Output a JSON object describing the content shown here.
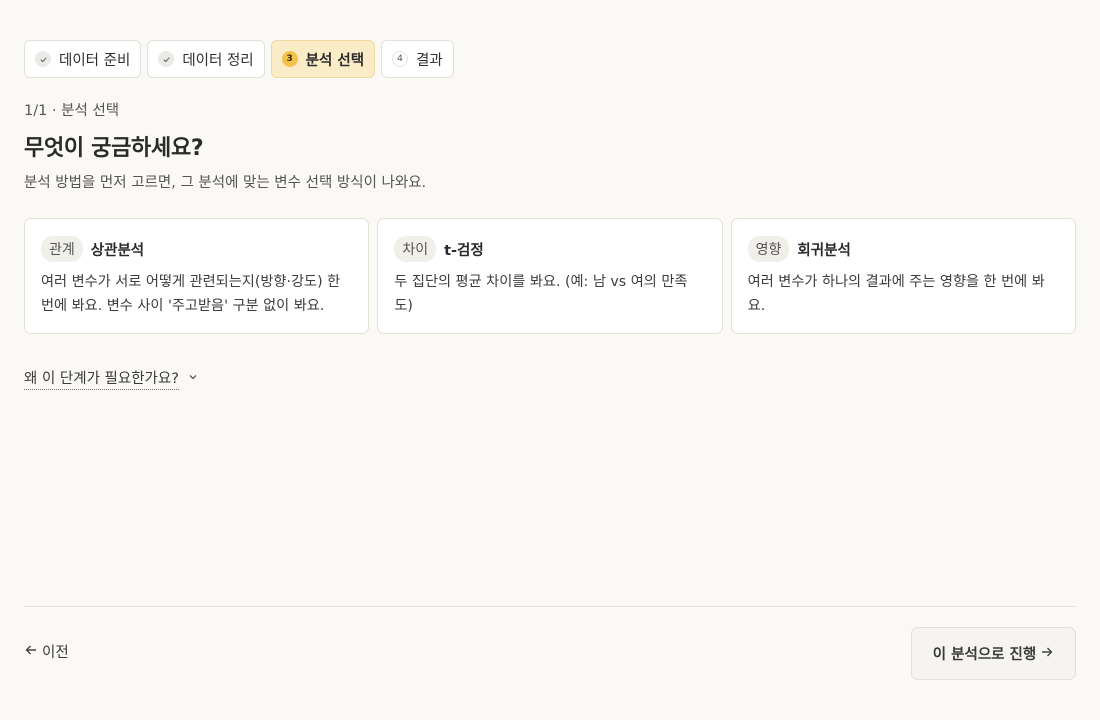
{
  "stepper": {
    "steps": [
      {
        "label": "데이터 준비",
        "state": "done",
        "icon": "check-icon"
      },
      {
        "label": "데이터 정리",
        "state": "done",
        "icon": "check-icon"
      },
      {
        "label": "분석 선택",
        "state": "current",
        "number": "3"
      },
      {
        "label": "결과",
        "state": "upcoming",
        "number": "4"
      }
    ]
  },
  "progress": "1/1 · 분석 선택",
  "title": "무엇이 궁금하세요?",
  "subtitle": "분석 방법을 먼저 고르면, 그 분석에 맞는 변수 선택 방식이 나와요.",
  "cards": [
    {
      "tag": "관계",
      "title": "상관분석",
      "desc": "여러 변수가 서로 어떻게 관련되는지(방향·강도) 한 번에 봐요. 변수 사이 '주고받음' 구분 없이 봐요."
    },
    {
      "tag": "차이",
      "title": "t-검정",
      "desc": "두 집단의 평균 차이를 봐요. (예: 남 vs 여의 만족도)"
    },
    {
      "tag": "영향",
      "title": "회귀분석",
      "desc": "여러 변수가 하나의 결과에 주는 영향을 한 번에 봐요."
    }
  ],
  "why_toggle": {
    "label": "왜 이 단계가 필요한가요?",
    "icon": "chevron-down-icon"
  },
  "footer": {
    "prev_label": "이전",
    "prev_icon": "arrow-left-icon",
    "next_label": "이 분석으로 진행",
    "next_icon": "arrow-right-icon"
  },
  "colors": {
    "background": "#faf9f6",
    "active_step": "#fbecc8",
    "active_badge": "#f4c24b"
  }
}
